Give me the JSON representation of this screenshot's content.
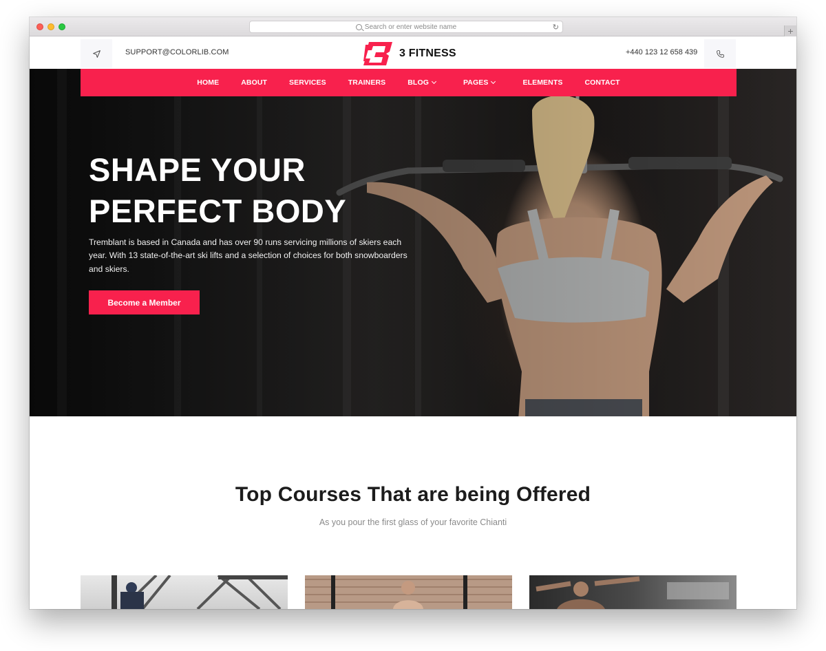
{
  "browser": {
    "url_placeholder": "Search or enter website name"
  },
  "header": {
    "email": "SUPPORT@COLORLIB.COM",
    "brand": "3 FITNESS",
    "phone": "+440 123 12 658 439",
    "location_icon": "navigation-arrow-icon",
    "phone_icon": "phone-icon"
  },
  "nav": {
    "items": [
      {
        "label": "HOME"
      },
      {
        "label": "ABOUT"
      },
      {
        "label": "SERVICES"
      },
      {
        "label": "TRAINERS"
      },
      {
        "label": "BLOG"
      },
      {
        "label": "PAGES"
      },
      {
        "label": "ELEMENTS"
      },
      {
        "label": "CONTACT"
      }
    ]
  },
  "hero": {
    "title_line1": "SHAPE YOUR",
    "title_line2": "PERFECT BODY",
    "description": "Tremblant is based in Canada and has over 90 runs servicing millions of skiers each year. With 13 state-of-the-art ski lifts and a selection of choices for both snowboarders and skiers.",
    "cta_label": "Become a Member"
  },
  "courses": {
    "title": "Top Courses That are being Offered",
    "subtitle": "As you pour the first glass of your favorite Chianti"
  },
  "colors": {
    "accent": "#f8214d",
    "heading": "#1c1c1c",
    "muted": "#8a8a8a"
  }
}
